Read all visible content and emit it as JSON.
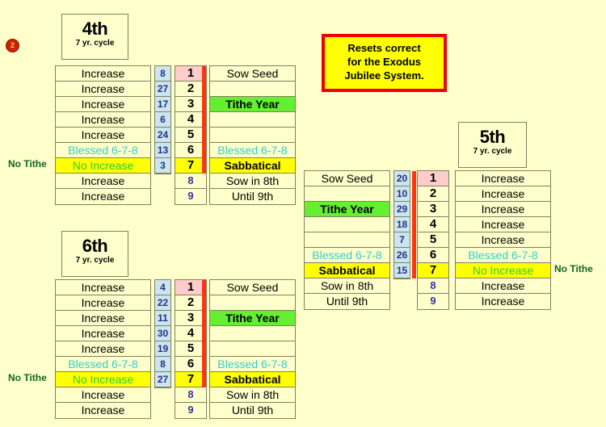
{
  "page": {
    "background_color": "#ffffcc",
    "marker": {
      "label": "2",
      "color": "#cc2200"
    }
  },
  "notice": {
    "border_color": "#ee0000",
    "background_color": "#ffff00",
    "lines": [
      "Resets correct",
      "for  the Exodus",
      "Jubilee System."
    ]
  },
  "labels": {
    "no_tithe": "No Tithe",
    "cycle_sub": "7 yr. cycle"
  },
  "colors": {
    "tithe_green": "#66ee33",
    "sabbatical_yellow": "#ffff00",
    "blessed_teal": "#33cccc",
    "no_increase_green": "#33cc33",
    "year1_pink": "#ffcccc",
    "blue_col": "#cce5ee",
    "blue_num": "#223388",
    "red_bar": "#ff3311",
    "grid_border": "#808060",
    "no_tithe_green": "#116622"
  },
  "cycles": {
    "fourth": {
      "title_ordinal": "4th",
      "title_sub": "7 yr. cycle",
      "left_column": [
        "Increase",
        "Increase",
        "Increase",
        "Increase",
        "Increase",
        "Blessed 6-7-8",
        "No Increase",
        "Increase",
        "Increase"
      ],
      "blue_numbers": [
        "8",
        "27",
        "17",
        "6",
        "24",
        "13",
        "3"
      ],
      "year_numbers": [
        "1",
        "2",
        "3",
        "4",
        "5",
        "6",
        "7",
        "8",
        "9"
      ],
      "right_column": [
        "Sow Seed",
        "",
        "Tithe Year",
        "",
        "",
        "Blessed 6-7-8",
        "Sabbatical",
        "Sow in 8th",
        "Until 9th"
      ],
      "side_label": "No Tithe",
      "side_label_position": "left"
    },
    "fifth": {
      "title_ordinal": "5th",
      "title_sub": "7 yr. cycle",
      "left_column": [
        "Sow Seed",
        "",
        "Tithe Year",
        "",
        "",
        "Blessed 6-7-8",
        "Sabbatical",
        "Sow in 8th",
        "Until 9th"
      ],
      "blue_numbers": [
        "20",
        "10",
        "29",
        "18",
        "7",
        "26",
        "15"
      ],
      "year_numbers": [
        "1",
        "2",
        "3",
        "4",
        "5",
        "6",
        "7",
        "8",
        "9"
      ],
      "right_column": [
        "Increase",
        "Increase",
        "Increase",
        "Increase",
        "Increase",
        "Blessed 6-7-8",
        "No Increase",
        "Increase",
        "Increase"
      ],
      "side_label": "No Tithe",
      "side_label_position": "right"
    },
    "sixth": {
      "title_ordinal": "6th",
      "title_sub": "7 yr. cycle",
      "left_column": [
        "Increase",
        "Increase",
        "Increase",
        "Increase",
        "Increase",
        "Blessed 6-7-8",
        "No Increase",
        "Increase",
        "Increase"
      ],
      "blue_numbers": [
        "4",
        "22",
        "11",
        "30",
        "19",
        "8",
        "27"
      ],
      "year_numbers": [
        "1",
        "2",
        "3",
        "4",
        "5",
        "6",
        "7",
        "8",
        "9"
      ],
      "right_column": [
        "Sow Seed",
        "",
        "Tithe Year",
        "",
        "",
        "Blessed 6-7-8",
        "Sabbatical",
        "Sow in 8th",
        "Until 9th"
      ],
      "side_label": "No Tithe",
      "side_label_position": "left"
    }
  }
}
